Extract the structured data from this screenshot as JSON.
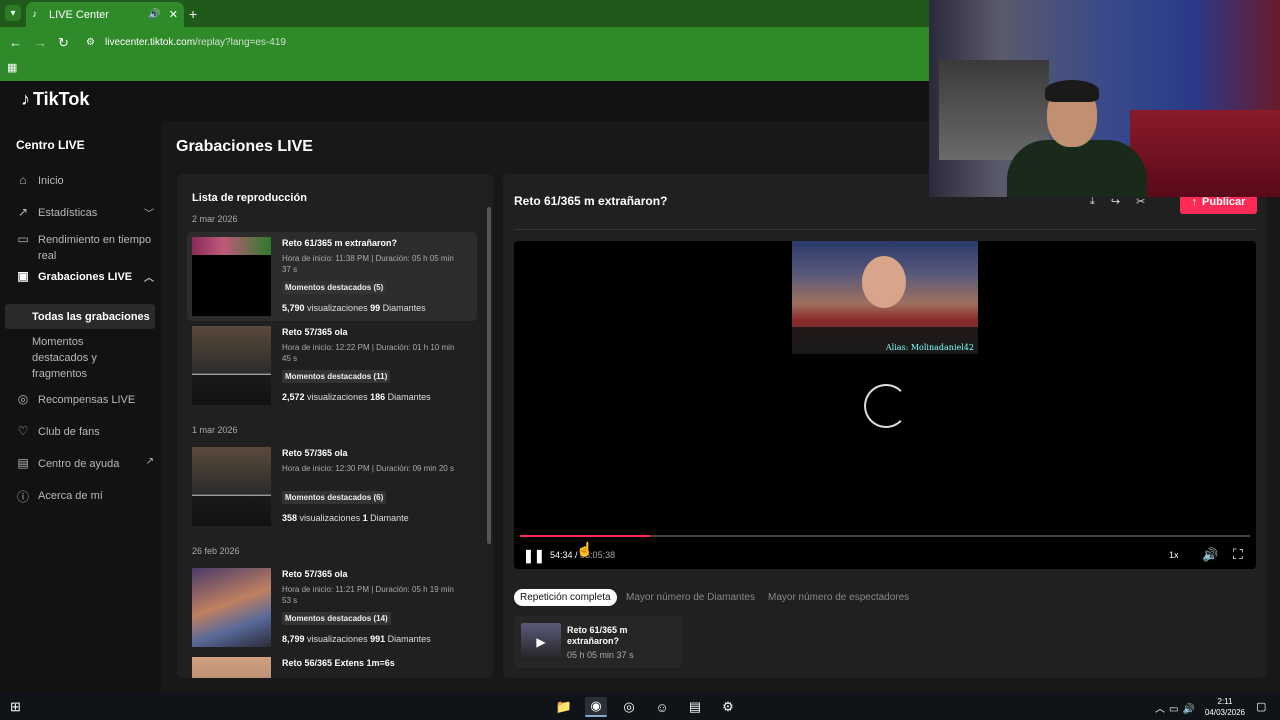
{
  "browser": {
    "tab_title": "LIVE Center",
    "url_host": "livecenter.tiktok.com",
    "url_path": "/replay?lang=es-419"
  },
  "brand": {
    "name": "TikTok"
  },
  "sidebar": {
    "title": "Centro LIVE",
    "items": [
      {
        "label": "Inicio",
        "icon": "home-icon"
      },
      {
        "label": "Estadísticas",
        "icon": "chart-icon"
      },
      {
        "label": "Rendimiento en tiempo real",
        "icon": "monitor-icon"
      },
      {
        "label": "Grabaciones LIVE",
        "icon": "recordings-icon"
      },
      {
        "label": "Recompensas LIVE",
        "icon": "reward-icon"
      },
      {
        "label": "Club de fans",
        "icon": "heart-icon"
      },
      {
        "label": "Centro de ayuda",
        "icon": "help-icon"
      },
      {
        "label": "Acerca de mí",
        "icon": "user-icon"
      }
    ],
    "sub_all": "Todas las grabaciones",
    "sub_moments": "Momentos destacados y fragmentos"
  },
  "page": {
    "title": "Grabaciones LIVE"
  },
  "playlist": {
    "title": "Lista de reproducción",
    "dates": [
      "2 mar 2026",
      "1 mar 2026",
      "26 feb 2026"
    ],
    "entries": [
      {
        "name": "Reto 61/365 m extrañaron?",
        "meta": "Hora de inicio: 11:38 PM | Duración: 05 h 05 min 37 s",
        "badge": "Momentos destacados (5)",
        "views": "5,790",
        "views_label": "visualizaciones",
        "diamonds": "99",
        "diamonds_label": "Diamantes"
      },
      {
        "name": "Reto 57/365 ola",
        "meta": "Hora de inicio: 12:22 PM | Duración: 01 h 10 min 45 s",
        "badge": "Momentos destacados (11)",
        "views": "2,572",
        "views_label": "visualizaciones",
        "diamonds": "186",
        "diamonds_label": "Diamantes"
      },
      {
        "name": "Reto 57/365 ola",
        "meta": "Hora de inicio: 12:30 PM | Duración: 09 min 20 s",
        "badge": "Momentos destacados (6)",
        "views": "358",
        "views_label": "visualizaciones",
        "diamonds": "1",
        "diamonds_label": "Diamante"
      },
      {
        "name": "Reto 57/365 ola",
        "meta": "Hora de inicio: 11:21 PM | Duración: 05 h 19 min 53 s",
        "badge": "Momentos destacados (14)",
        "views": "8,799",
        "views_label": "visualizaciones",
        "diamonds": "991",
        "diamonds_label": "Diamantes"
      },
      {
        "name": "Reto 56/365 Extens 1m=6s"
      }
    ]
  },
  "player": {
    "title": "Reto 61/365 m extrañaron?",
    "publish_label": "Publicar",
    "overlay_alias": "Alias: Molinadaniel42",
    "time_current": "54:34",
    "time_total": "05:05:38",
    "progress": 0.178,
    "speed": "1x",
    "tabs": [
      "Repetición completa",
      "Mayor número de Diamantes",
      "Mayor número de espectadores"
    ],
    "clip_name": "Reto 61/365 m extrañaron?",
    "clip_duration": "05 h 05 min 37 s"
  },
  "taskbar": {
    "time": "2:11",
    "date": "04/03/2026"
  },
  "colors": {
    "accent": "#fe2c55",
    "browser_green": "#2f8a2a"
  }
}
